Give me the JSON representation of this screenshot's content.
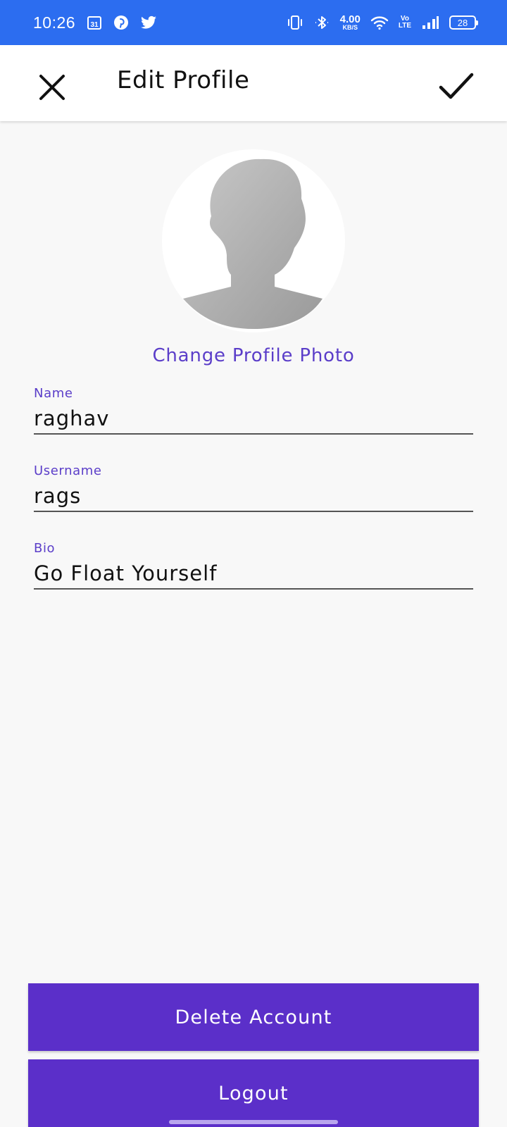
{
  "status_bar": {
    "time": "10:26",
    "calendar_day": "31",
    "net_speed_value": "4.00",
    "net_speed_unit": "KB/S",
    "volte_top": "Vo",
    "volte_bottom": "LTE",
    "battery": "28",
    "icons": [
      "calendar-icon",
      "pinterest-icon",
      "twitter-icon",
      "vibrate-icon",
      "bluetooth-icon",
      "wifi-icon",
      "signal-icon",
      "battery-icon"
    ],
    "color": "#2c6df0"
  },
  "app_bar": {
    "title": "Edit Profile",
    "close_icon": "close-icon",
    "confirm_icon": "check-icon"
  },
  "profile": {
    "change_photo_label": "Change Profile Photo",
    "avatar_icon": "default-avatar-icon"
  },
  "fields": {
    "name": {
      "label": "Name",
      "value": "raghav"
    },
    "username": {
      "label": "Username",
      "value": "rags"
    },
    "bio": {
      "label": "Bio",
      "value": "Go Float Yourself"
    }
  },
  "actions": {
    "delete_label": "Delete Account",
    "logout_label": "Logout"
  },
  "colors": {
    "accent": "#5b3ec9",
    "button": "#5b2fc9",
    "background": "#f8f8f8"
  }
}
